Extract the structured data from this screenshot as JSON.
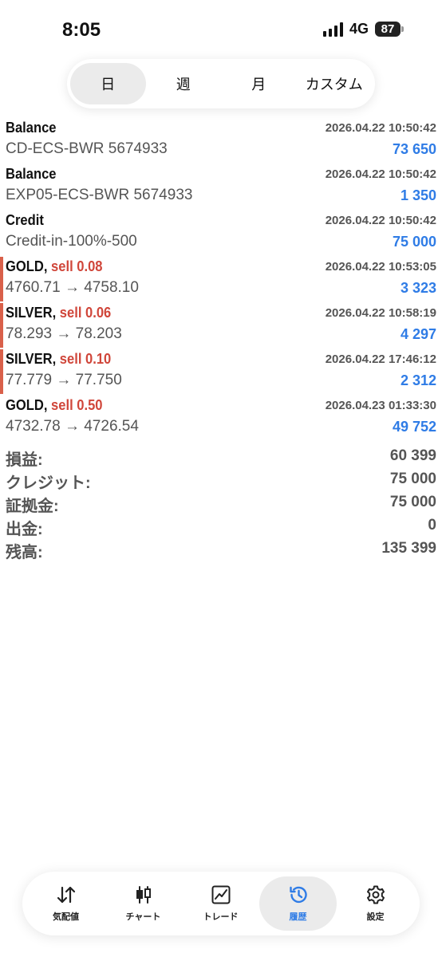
{
  "status_bar": {
    "time": "8:05",
    "network": "4G",
    "battery": "87"
  },
  "period_tabs": [
    {
      "label": "日",
      "active": true
    },
    {
      "label": "週",
      "active": false
    },
    {
      "label": "月",
      "active": false
    },
    {
      "label": "カスタム",
      "active": false
    }
  ],
  "history": [
    {
      "title": "Balance",
      "action": "",
      "datetime": "2026.04.22 10:50:42",
      "detail": "CD-ECS-BWR 5674933",
      "amount": "73 650"
    },
    {
      "title": "Balance",
      "action": "",
      "datetime": "2026.04.22 10:50:42",
      "detail": "EXP05-ECS-BWR 5674933",
      "amount": "1 350"
    },
    {
      "title": "Credit",
      "action": "",
      "datetime": "2026.04.22 10:50:42",
      "detail": "Credit-in-100%-500",
      "amount": "75 000"
    },
    {
      "title": "GOLD,",
      "action": "sell 0.08",
      "datetime": "2026.04.22 10:53:05",
      "detail": "4760.71 → 4758.10",
      "amount": "3 323"
    },
    {
      "title": "SILVER,",
      "action": "sell 0.06",
      "datetime": "2026.04.22 10:58:19",
      "detail": "78.293 → 78.203",
      "amount": "4 297"
    },
    {
      "title": "SILVER,",
      "action": "sell 0.10",
      "datetime": "2026.04.22 17:46:12",
      "detail": "77.779 → 77.750",
      "amount": "2 312"
    },
    {
      "title": "GOLD,",
      "action": "sell 0.50",
      "datetime": "2026.04.23 01:33:30",
      "detail": "4732.78 → 4726.54",
      "amount": "49 752"
    }
  ],
  "summary": [
    {
      "label": "損益:",
      "value": "60 399"
    },
    {
      "label": "クレジット:",
      "value": "75 000"
    },
    {
      "label": "証拠金:",
      "value": "75 000"
    },
    {
      "label": "出金:",
      "value": "0"
    },
    {
      "label": "残高:",
      "value": "135 399"
    }
  ],
  "bottom_nav": [
    {
      "label": "気配値",
      "icon": "quotes-arrows-icon",
      "active": false
    },
    {
      "label": "チャート",
      "icon": "candlestick-chart-icon",
      "active": false
    },
    {
      "label": "トレード",
      "icon": "trade-chart-icon",
      "active": false
    },
    {
      "label": "履歴",
      "icon": "history-clock-icon",
      "active": true
    },
    {
      "label": "設定",
      "icon": "gear-icon",
      "active": false
    }
  ],
  "colors": {
    "sell": "#d0463a",
    "amount": "#2f7ce6",
    "accent_bar": "#d9604a",
    "active_nav": "#2f7ce6"
  }
}
